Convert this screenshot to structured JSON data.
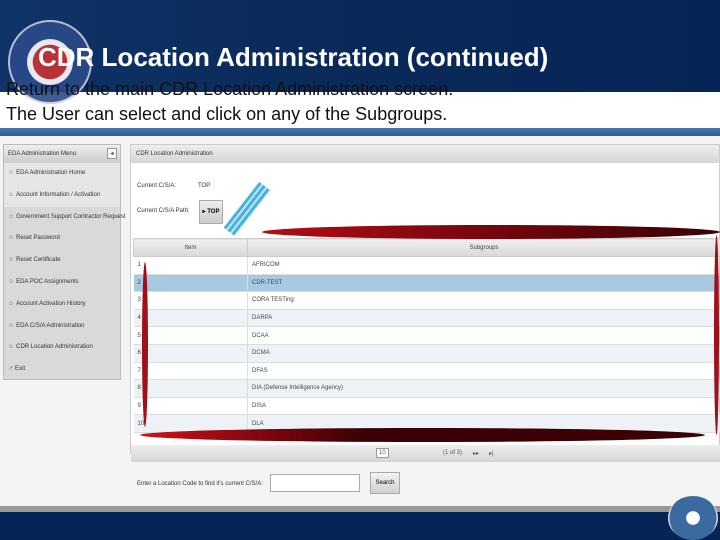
{
  "slide": {
    "title": "CDR Location Administration (continued)",
    "line1": "Return to the main CDR Location Administration screen.",
    "line2": "The User can select and click on any of the Subgroups."
  },
  "sidebar": {
    "header": "EDA Administration Menu",
    "collapse_icon": "◂",
    "items": [
      {
        "label": "EDA Administration Home",
        "icon": "home-icon"
      },
      {
        "label": "Account Information / Activation",
        "icon": "user-icon"
      },
      {
        "label": "Government Support Contractor Request",
        "icon": "user-icon"
      },
      {
        "label": "Reset Password",
        "icon": "user-icon"
      },
      {
        "label": "Reset Certificate",
        "icon": "user-icon"
      },
      {
        "label": "EDA POC Assignments",
        "icon": "user-icon"
      },
      {
        "label": "Account Activation History",
        "icon": "user-icon"
      },
      {
        "label": "EDA C/S/A Administration",
        "icon": "user-icon"
      },
      {
        "label": "CDR Location Administration",
        "icon": "user-icon"
      },
      {
        "label": "Exit",
        "icon": "exit-icon"
      }
    ]
  },
  "main": {
    "header": "CDR Location Administration",
    "csa_label": "Current C/S/A:",
    "csa_value": "TOP",
    "path_label": "Current C/S/A Path:",
    "path_button": "▸ TOP",
    "table": {
      "columns": [
        "Item",
        "Subgroups"
      ],
      "rows": [
        {
          "n": "1",
          "name": "AFRICOM"
        },
        {
          "n": "2",
          "name": "CDR-TEST",
          "selected": true
        },
        {
          "n": "3",
          "name": "CORA TESTing"
        },
        {
          "n": "4",
          "name": "DARPA"
        },
        {
          "n": "5",
          "name": "DCAA"
        },
        {
          "n": "6",
          "name": "DCMA"
        },
        {
          "n": "7",
          "name": "DFAS"
        },
        {
          "n": "8",
          "name": "DIA (Defense Intelligence Agency)"
        },
        {
          "n": "9",
          "name": "DISA"
        },
        {
          "n": "10",
          "name": "DLA"
        }
      ]
    },
    "pager": {
      "page_size": "10",
      "status": "(1 of 3)",
      "next": "▸▸",
      "last": "▸|"
    },
    "search_label": "Enter a Location Code to find it's current C/S/A:",
    "search_value": "",
    "search_button": "Search"
  }
}
